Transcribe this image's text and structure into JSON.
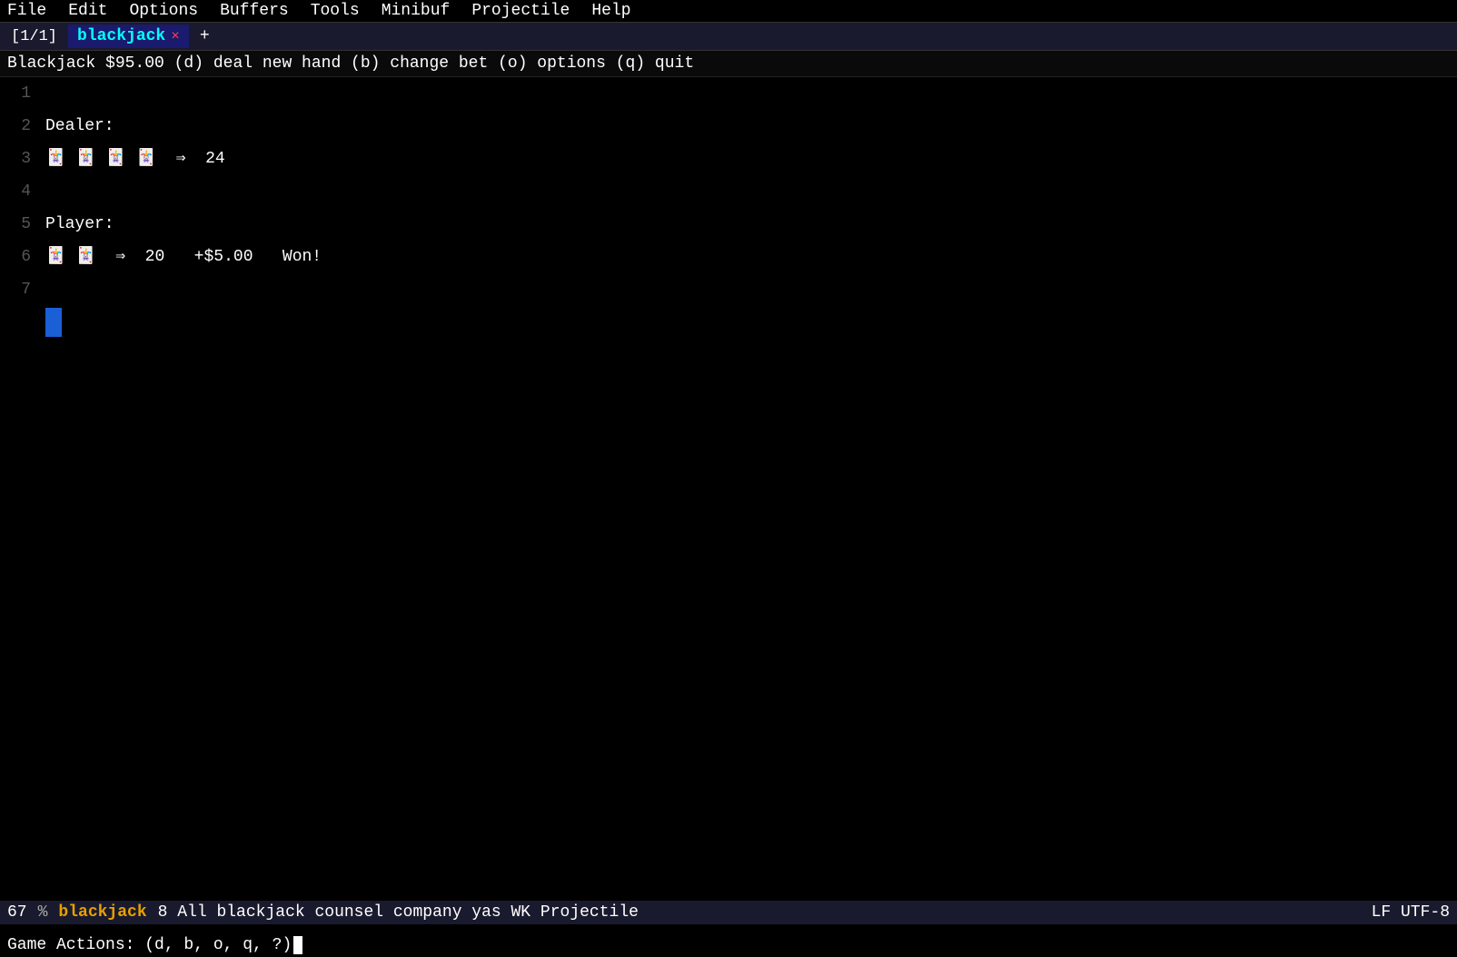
{
  "menu": {
    "items": [
      "File",
      "Edit",
      "Options",
      "Buffers",
      "Tools",
      "Minibuf",
      "Projectile",
      "Help"
    ]
  },
  "tabs": {
    "indicator": "[1/1]",
    "active_tab": "blackjack",
    "close_symbol": "×",
    "add_symbol": "+"
  },
  "status_line": {
    "text": "Blackjack $95.00   (d) deal new hand   (b) change bet   (o) options   (q) quit"
  },
  "editor": {
    "lines": [
      {
        "number": "1",
        "content": ""
      },
      {
        "number": "2",
        "content": "Dealer:"
      },
      {
        "number": "3",
        "content": "🂠 🂡 🂢 🂣  ⇒  24"
      },
      {
        "number": "4",
        "content": ""
      },
      {
        "number": "5",
        "content": "Player:"
      },
      {
        "number": "6",
        "content": "🂠 🂡  ⇒  20   +$5.00   Won!"
      },
      {
        "number": "7",
        "content": ""
      }
    ]
  },
  "bottom_bar": {
    "line_number": "67",
    "percent": "%",
    "buffer_name": "blackjack",
    "info": "8 All  blackjack  counsel  company  yas  WK  Projectile",
    "encoding": "LF  UTF-8"
  },
  "minibuf": {
    "text": "Game Actions: (d, b, o, q, ?)"
  }
}
